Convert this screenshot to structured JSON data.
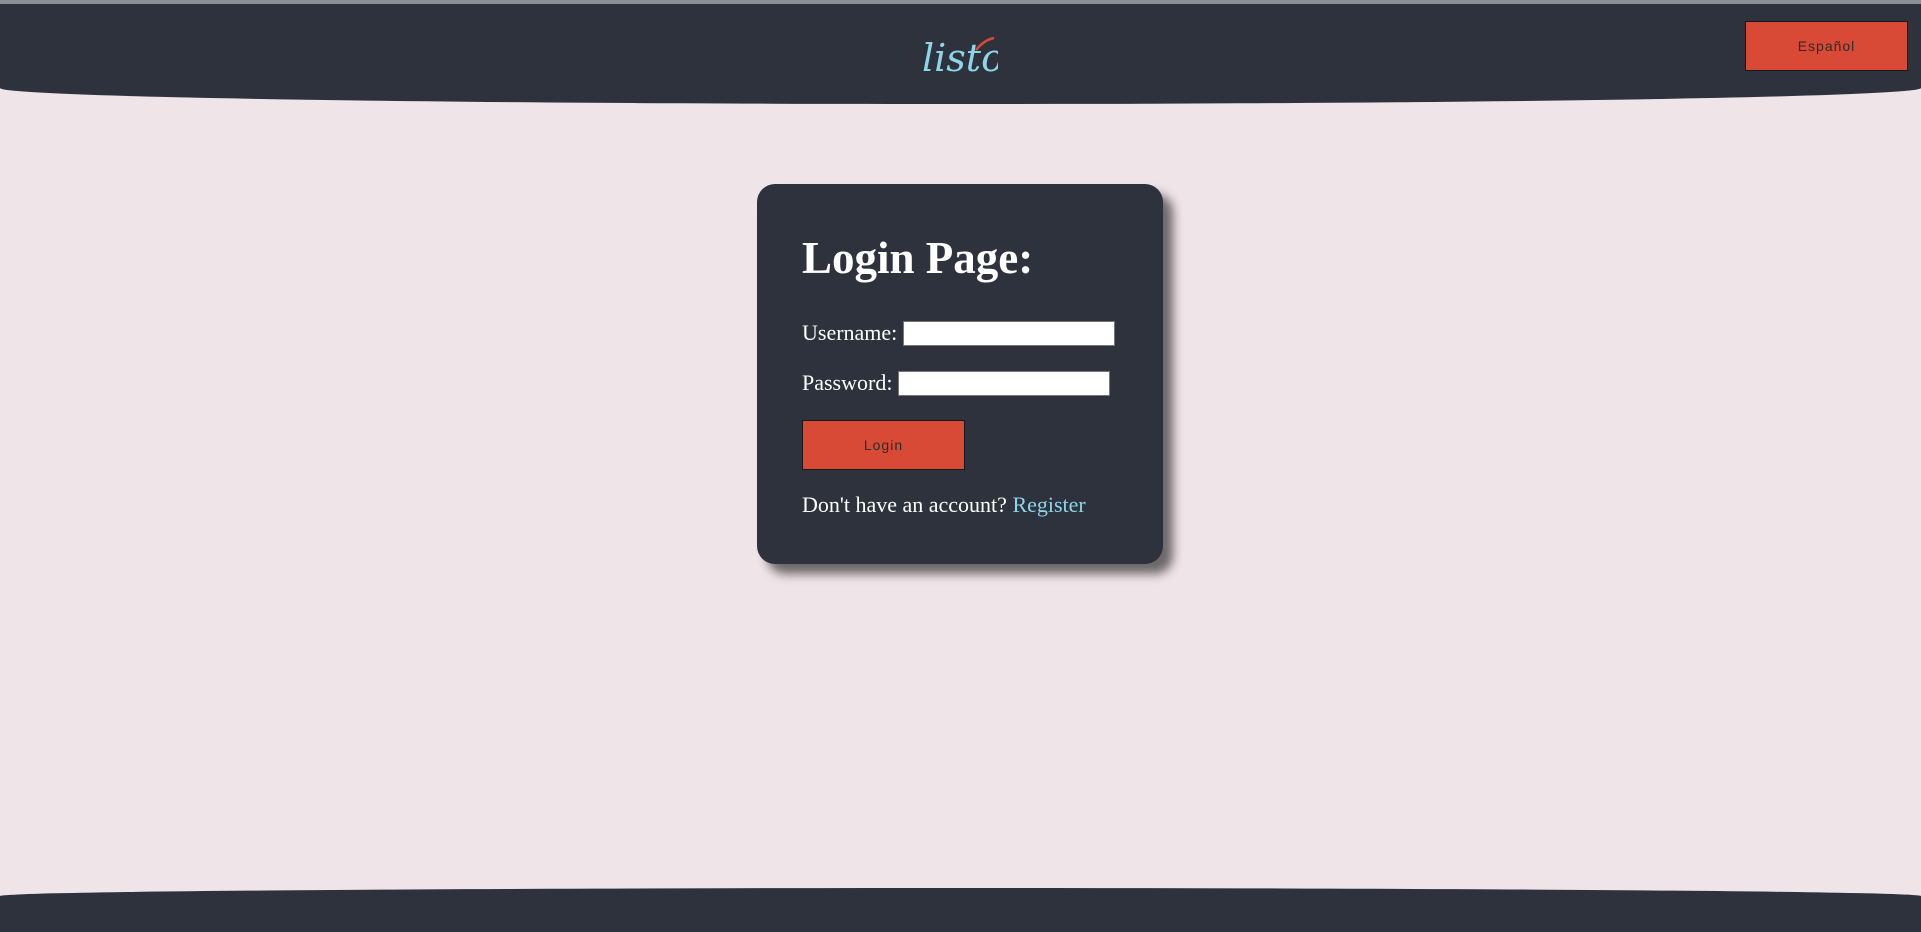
{
  "header": {
    "logo_text": "listo",
    "language_button": "Español"
  },
  "login": {
    "title": "Login Page:",
    "username_label": "Username:",
    "username_value": "",
    "password_label": "Password:",
    "password_value": "",
    "login_button": "Login",
    "no_account_text": "Don't have an account?",
    "register_link": "Register"
  },
  "colors": {
    "background": "#efe4e8",
    "header_footer": "#2d323d",
    "accent_button": "#d84a35",
    "logo": "#8dd6e9",
    "link": "#8dd6e9",
    "logo_check": "#d84a35"
  },
  "icons": {
    "logo": "listo-logo-icon"
  }
}
